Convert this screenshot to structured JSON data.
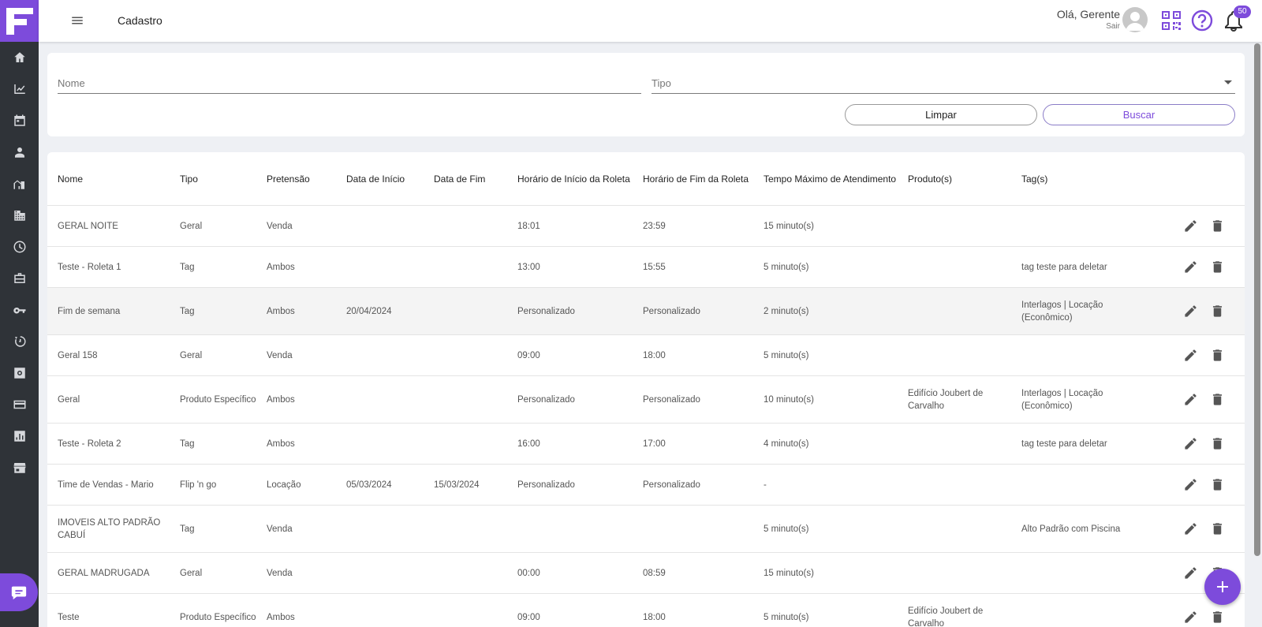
{
  "header": {
    "title": "Cadastro",
    "greeting": "Olá, Gerente",
    "logout": "Sair",
    "notifications_count": "50"
  },
  "sidebar": {
    "items": [
      "home-icon",
      "chart-icon",
      "calendar-icon",
      "person-icon",
      "building-icon",
      "apartment-icon",
      "clock-icon",
      "briefcase-icon",
      "key-icon",
      "history-icon",
      "settings-box-icon",
      "card-icon",
      "bar-chart-icon",
      "store-icon"
    ]
  },
  "filters": {
    "name_label": "Nome",
    "type_label": "Tipo",
    "clear_label": "Limpar",
    "search_label": "Buscar"
  },
  "table": {
    "columns": [
      "Nome",
      "Tipo",
      "Pretensão",
      "Data de Início",
      "Data de Fim",
      "Horário de Início da Roleta",
      "Horário de Fim da Roleta",
      "Tempo Máximo de Atendimento",
      "Produto(s)",
      "Tag(s)"
    ],
    "rows": [
      [
        "GERAL NOITE",
        "Geral",
        "Venda",
        "",
        "",
        "18:01",
        "23:59",
        "15 minuto(s)",
        "",
        ""
      ],
      [
        "Teste - Roleta 1",
        "Tag",
        "Ambos",
        "",
        "",
        "13:00",
        "15:55",
        "5 minuto(s)",
        "",
        "tag teste para deletar"
      ],
      [
        "Fim de semana",
        "Tag",
        "Ambos",
        "20/04/2024",
        "",
        "Personalizado",
        "Personalizado",
        "2 minuto(s)",
        "",
        "Interlagos | Locação (Econômico)"
      ],
      [
        "Geral 158",
        "Geral",
        "Venda",
        "",
        "",
        "09:00",
        "18:00",
        "5 minuto(s)",
        "",
        ""
      ],
      [
        "Geral",
        "Produto Específico",
        "Ambos",
        "",
        "",
        "Personalizado",
        "Personalizado",
        "10 minuto(s)",
        "Edifício Joubert de Carvalho",
        "Interlagos | Locação (Econômico)"
      ],
      [
        "Teste - Roleta 2",
        "Tag",
        "Ambos",
        "",
        "",
        "16:00",
        "17:00",
        "4 minuto(s)",
        "",
        "tag teste para deletar"
      ],
      [
        "Time de Vendas - Mario",
        "Flip 'n go",
        "Locação",
        "05/03/2024",
        "15/03/2024",
        "Personalizado",
        "Personalizado",
        "-",
        "",
        ""
      ],
      [
        "IMOVEIS ALTO PADRÃO CABUÍ",
        "Tag",
        "Venda",
        "",
        "",
        "",
        "",
        "5 minuto(s)",
        "",
        "Alto Padrão com Piscina"
      ],
      [
        "GERAL MADRUGADA",
        "Geral",
        "Venda",
        "",
        "",
        "00:00",
        "08:59",
        "15 minuto(s)",
        "",
        ""
      ],
      [
        "Teste",
        "Produto Específico",
        "Ambos",
        "",
        "",
        "09:00",
        "18:00",
        "5 minuto(s)",
        "Edifício Joubert de Carvalho",
        ""
      ]
    ]
  },
  "colors": {
    "accent": "#7d4bdb",
    "sidebar_bg": "#2f3338",
    "page_bg": "#eef0f4"
  }
}
